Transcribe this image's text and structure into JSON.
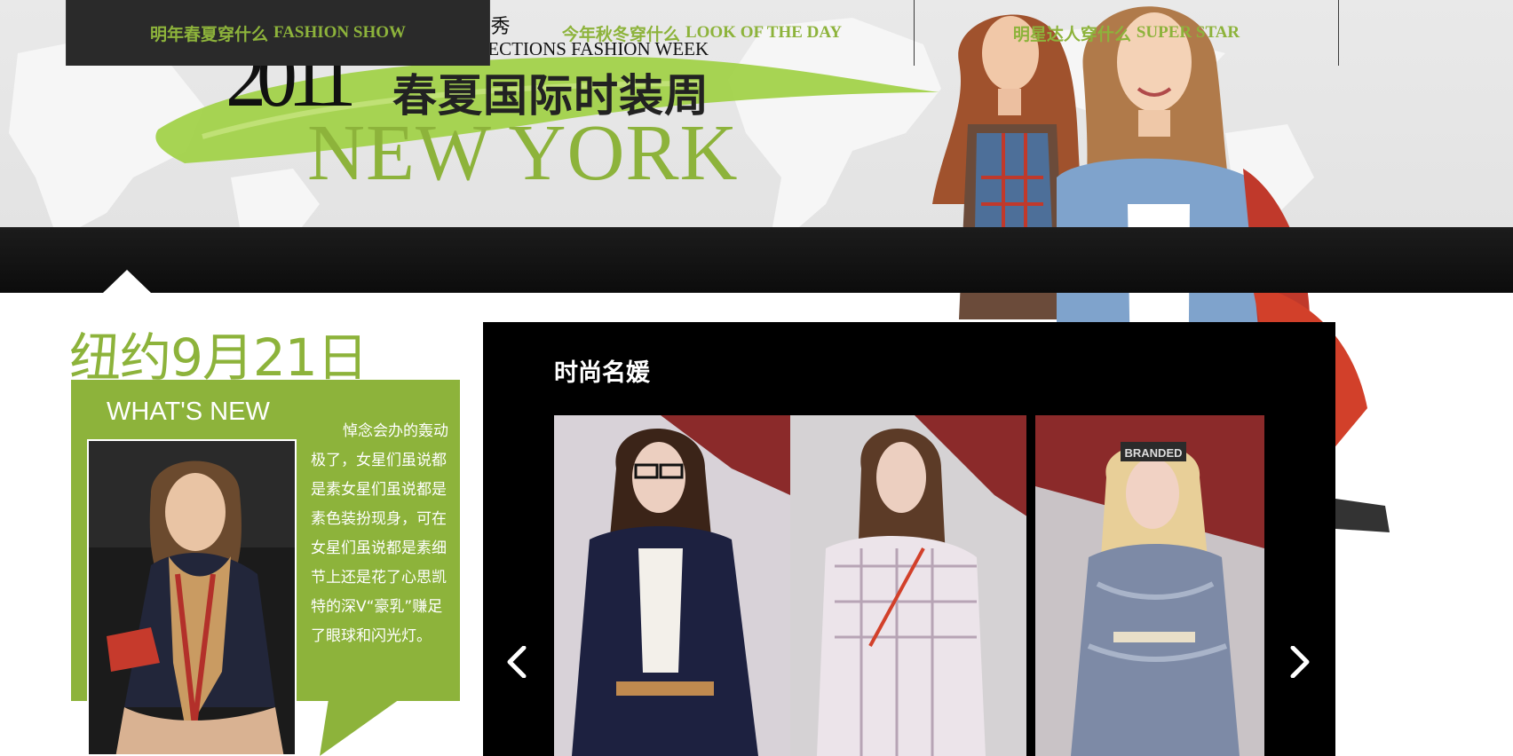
{
  "header": {
    "tagline": "街头 · 时装 · 秀",
    "subtitle": "S/S COLLECTIONS FASHION WEEK",
    "year": "2011",
    "title_cn": "春夏国际时装周",
    "city": "NEW YORK"
  },
  "nav": {
    "items": [
      {
        "cn": "明年春夏穿什么",
        "en": "FASHION SHOW"
      },
      {
        "cn": "今年秋冬穿什么",
        "en": "LOOK OF THE DAY"
      },
      {
        "cn": "明星达人穿什么",
        "en": "SUPER STAR"
      }
    ],
    "active_index": 0
  },
  "news": {
    "date_title": "纽约9月21日",
    "heading": "WHAT'S NEW",
    "body": "悼念会办的轰动极了，女星们虽说都是素女星们虽说都是素色装扮现身，可在女星们虽说都是素细节上还是花了心思凯特的深V“豪乳”赚足了眼球和闪光灯。"
  },
  "gallery": {
    "title": "时尚名媛",
    "headband_text": "BRANDED",
    "prev_icon": "chevron-left-icon",
    "next_icon": "chevron-right-icon"
  },
  "colors": {
    "accent_green": "#8db33b",
    "nav_bg": "#111111",
    "gallery_bg": "#000000"
  }
}
